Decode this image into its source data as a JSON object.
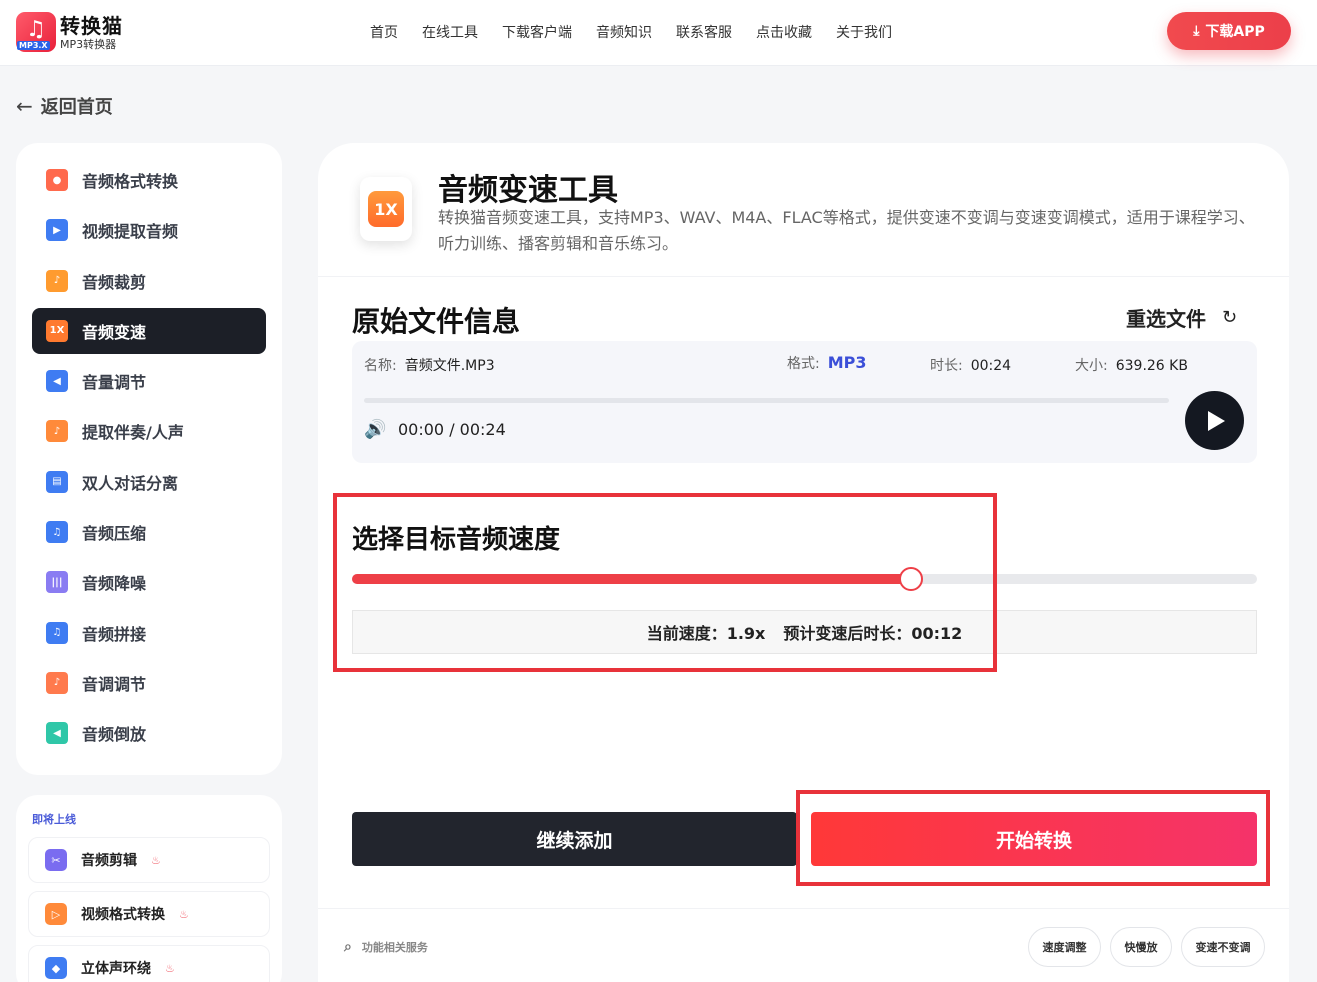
{
  "header": {
    "logo_name": "转换猫",
    "logo_sub": "MP3转换器",
    "logo_badge": "MP3.X",
    "nav": [
      "首页",
      "在线工具",
      "下载客户端",
      "音频知识",
      "联系客服",
      "点击收藏",
      "关于我们"
    ],
    "download_label": "下载APP"
  },
  "back_label": "返回首页",
  "sidebar": {
    "items": [
      {
        "label": "音频格式转换",
        "icon": "format-convert-icon",
        "color": "#ff6a4d"
      },
      {
        "label": "视频提取音频",
        "icon": "video-extract-icon",
        "color": "#3f7cf2"
      },
      {
        "label": "音频裁剪",
        "icon": "audio-cut-icon",
        "color": "#ff9b2f"
      },
      {
        "label": "音频变速",
        "icon": "speed-icon",
        "color": "#ff7a2f"
      },
      {
        "label": "音量调节",
        "icon": "volume-icon",
        "color": "#3f7cf2"
      },
      {
        "label": "提取伴奏/人声",
        "icon": "vocal-extract-icon",
        "color": "#ff8a3a"
      },
      {
        "label": "双人对话分离",
        "icon": "dialog-split-icon",
        "color": "#3f7cf2"
      },
      {
        "label": "音频压缩",
        "icon": "compress-icon",
        "color": "#3f7cf2"
      },
      {
        "label": "音频降噪",
        "icon": "denoise-icon",
        "color": "#8a7cf2"
      },
      {
        "label": "音频拼接",
        "icon": "merge-icon",
        "color": "#3f7cf2"
      },
      {
        "label": "音调调节",
        "icon": "pitch-icon",
        "color": "#ff7a4d"
      },
      {
        "label": "音频倒放",
        "icon": "reverse-icon",
        "color": "#2fc7a8"
      }
    ],
    "active_index": 3,
    "active_icon_text": "1X"
  },
  "coming_soon": {
    "title": "即将上线",
    "items": [
      {
        "label": "音频剪辑",
        "icon": "scissors-icon",
        "color": "#7a6cf0"
      },
      {
        "label": "视频格式转换",
        "icon": "video-play-icon",
        "color": "#ff8a3a"
      },
      {
        "label": "立体声环绕",
        "icon": "cube-icon",
        "color": "#3f7cf2"
      }
    ]
  },
  "tool": {
    "icon_text": "1X",
    "title": "音频变速工具",
    "description": "转换猫音频变速工具，支持MP3、WAV、M4A、FLAC等格式，提供变速不变调与变速变调模式，适用于课程学习、听力训练、播客剪辑和音乐练习。"
  },
  "file_info": {
    "section_title": "原始文件信息",
    "reselect_label": "重选文件",
    "name_key": "名称:",
    "name_value": "音频文件.MP3",
    "format_key": "格式:",
    "format_value": "MP3",
    "duration_key": "时长:",
    "duration_value": "00:24",
    "size_key": "大小:",
    "size_value": "639.26 KB",
    "time_display": "00:00 / 00:24",
    "playback_progress": 0
  },
  "speed": {
    "title": "选择目标音频速度",
    "slider_fraction": 0.618,
    "current_label": "当前速度：1.9x",
    "estimate_label": "预计变速后时长：00:12",
    "accent_color": "#ee3f47"
  },
  "actions": {
    "add_label": "继续添加",
    "start_label": "开始转换"
  },
  "bottom": {
    "search_label": "功能相关服务",
    "tags": [
      "速度调整",
      "快慢放",
      "变速不变调"
    ]
  }
}
